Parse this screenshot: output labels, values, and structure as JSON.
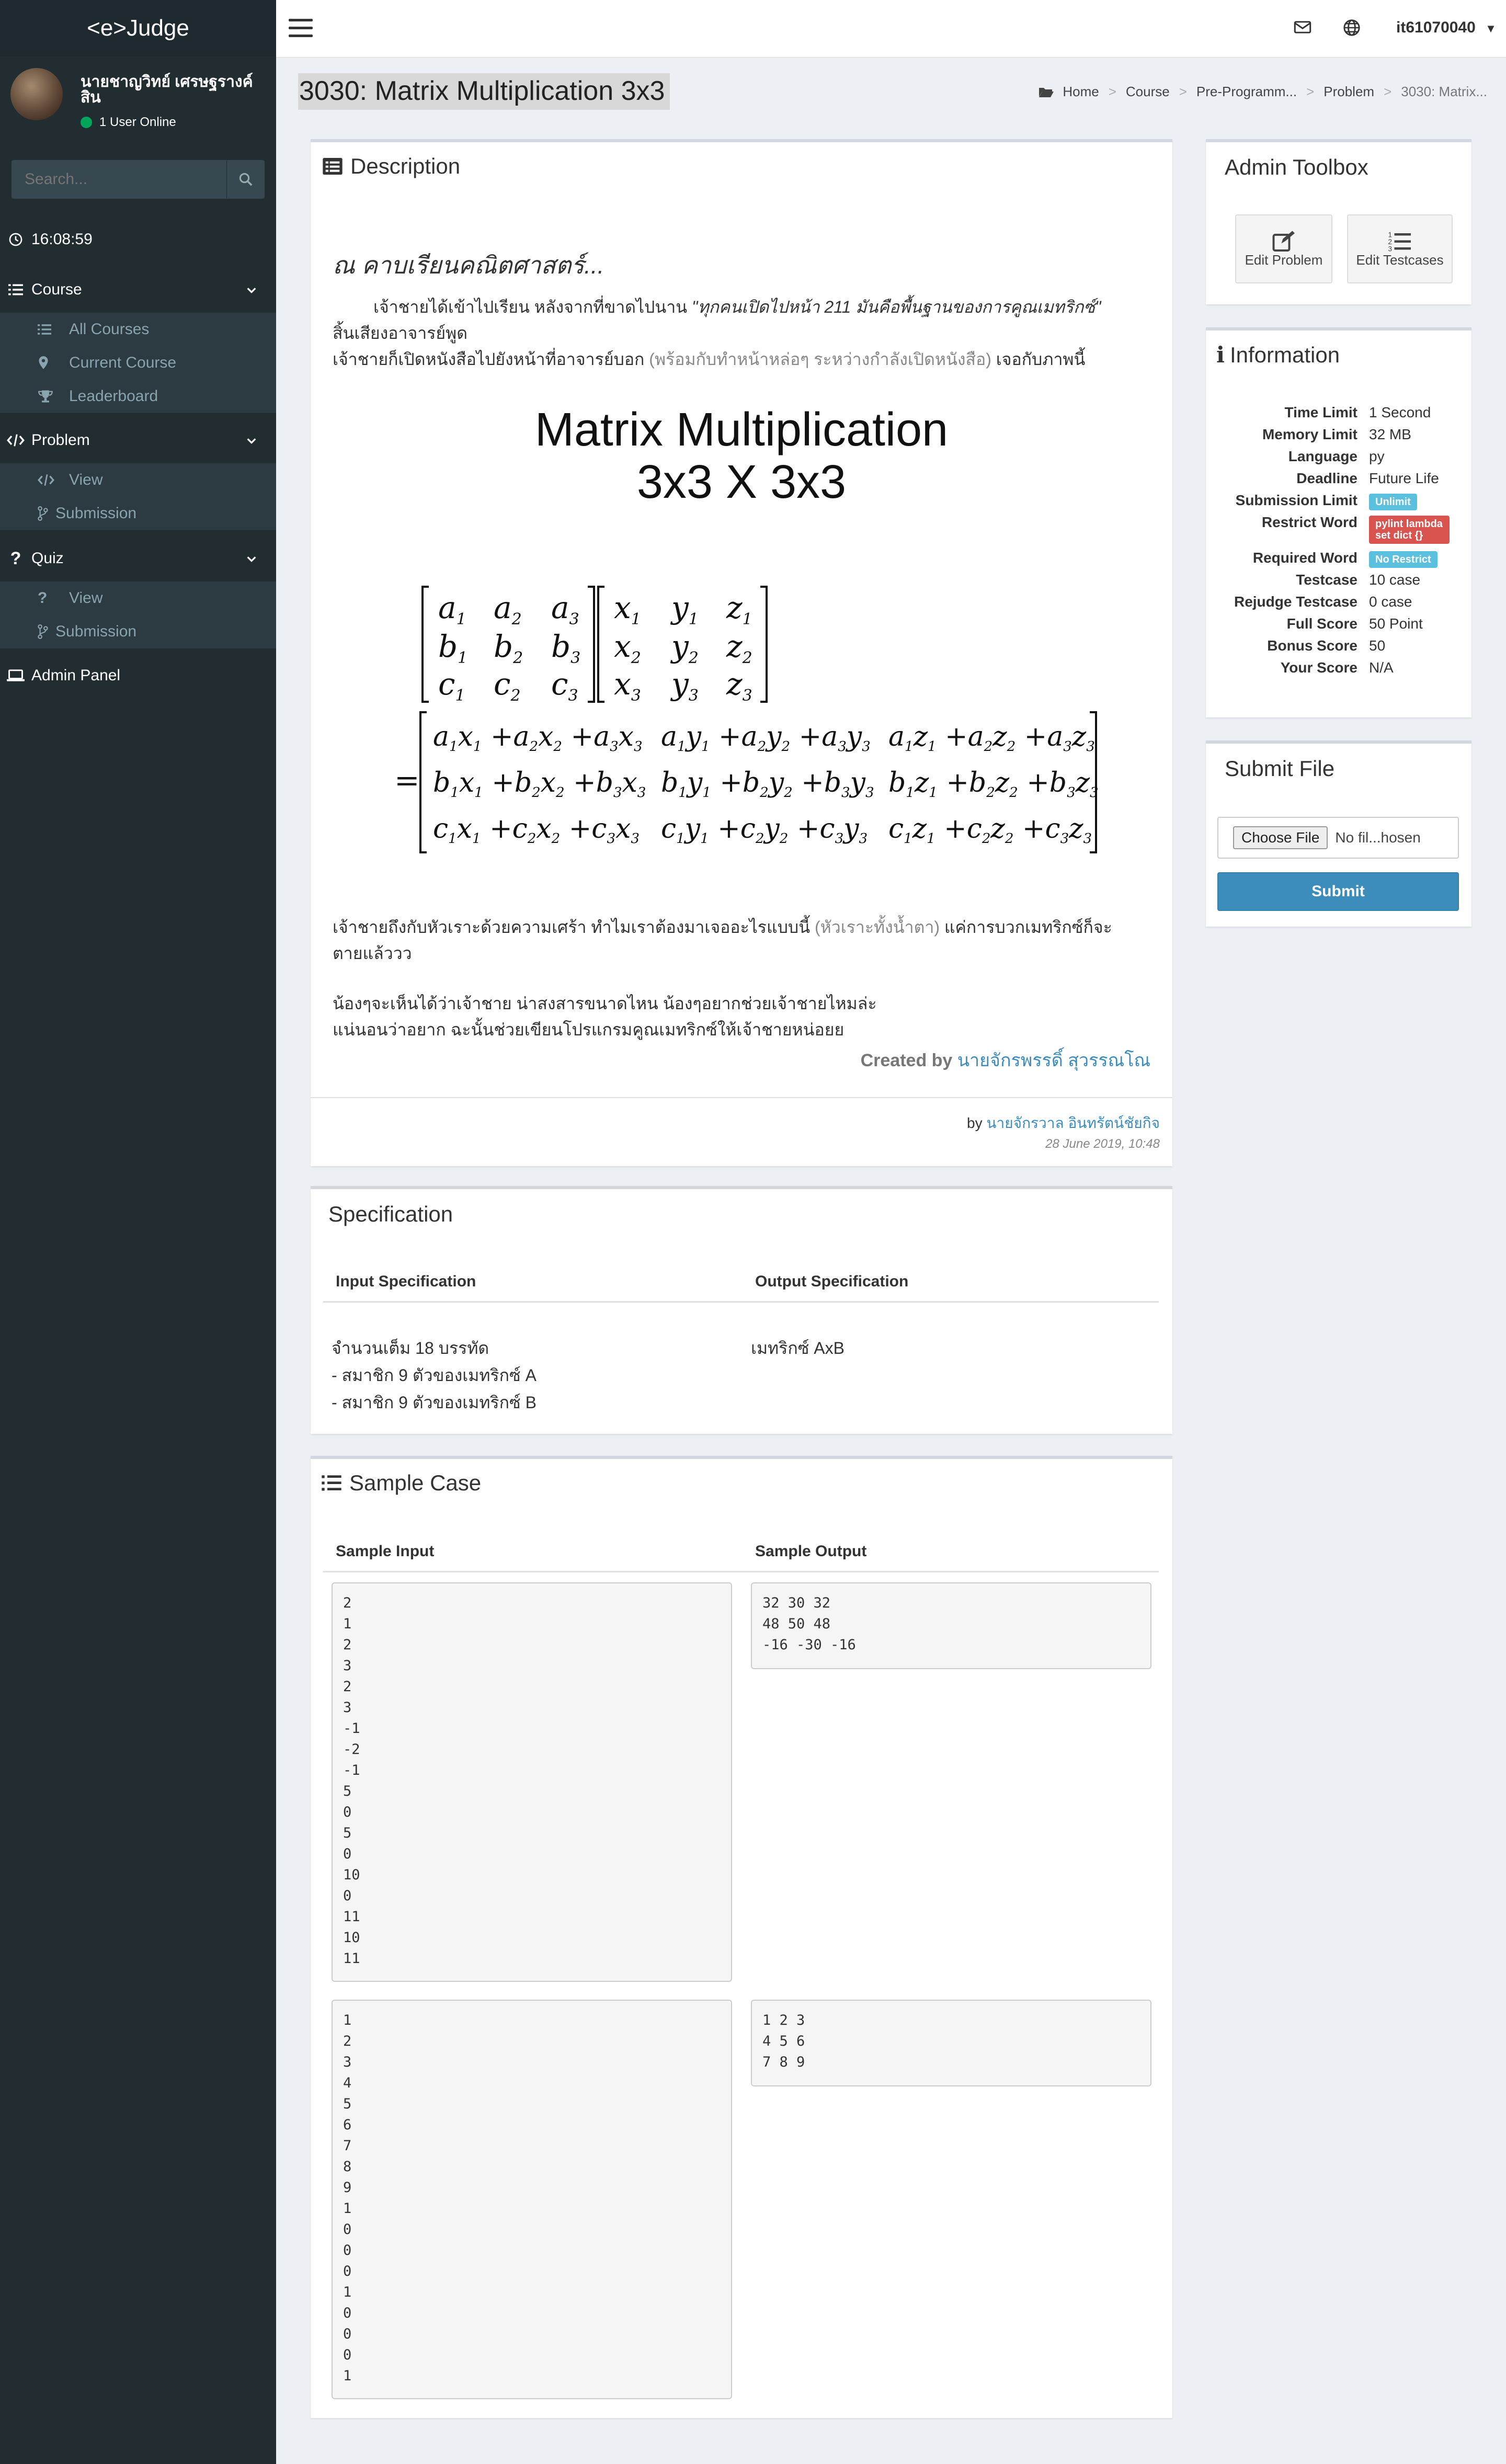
{
  "app": {
    "logo": "<e>Judge"
  },
  "user": {
    "name": "นายชาญวิทย์ เศรษฐรางค์สิน",
    "online": "1 User Online"
  },
  "search": {
    "placeholder": "Search..."
  },
  "clock": "16:08:59",
  "sidebar": {
    "course": {
      "label": "Course",
      "items": [
        "All Courses",
        "Current Course",
        "Leaderboard"
      ]
    },
    "problem": {
      "label": "Problem",
      "items": [
        "View",
        "Submission"
      ]
    },
    "quiz": {
      "label": "Quiz",
      "items": [
        "View",
        "Submission"
      ]
    },
    "admin": "Admin Panel"
  },
  "topbar": {
    "username": "it61070040"
  },
  "page": {
    "title": "3030: Matrix Multiplication 3x3"
  },
  "breadcrumb": [
    "Home",
    "Course",
    "Pre-Programm...",
    "Problem",
    "3030: Matrix..."
  ],
  "description": {
    "title": "Description",
    "heading": "ณ คาบเรียนคณิตศาสตร์...",
    "p1_a": "เจ้าชายได้เข้าไปเรียน หลังจากที่ขาดไปนาน",
    "p1_quote": "\"ทุกคนเปิดไปหน้า 211 มันคือพื้นฐานของการคูณเมทริกซ์\"",
    "p1_b": "สิ้นเสียงอาจารย์พูด",
    "p2_a": "เจ้าชายก็เปิดหนังสือไปยังหน้าที่อาจารย์บอก",
    "p2_note": "(พร้อมกับทำหน้าหล่อๆ ระหว่างกำลังเปิดหนังสือ)",
    "p2_b": "เจอกับภาพนี้",
    "img_title1": "Matrix Multiplication",
    "img_title2": "3x3  X  3x3",
    "p3_a": "เจ้าชายถึงกับหัวเราะด้วยความเศร้า ทำไมเราต้องมาเจออะไรแบบนี้",
    "p3_note": "(หัวเราะทั้งน้ำตา)",
    "p3_b": "แค่การบวกเมทริกซ์ก็จะ",
    "p3_c": "ตายแล้ววว",
    "p4": "น้องๆจะเห็นได้ว่าเจ้าชาย น่าสงสารขนาดไหน น้องๆอยากช่วยเจ้าชายไหมล่ะ",
    "p5": "แน่นอนว่าอยาก ฉะนั้นช่วยเขียนโปรแกรมคูณเมทริกซ์ให้เจ้าชายหน่อยย",
    "created_by_label": "Created by",
    "created_by_name": "นายจักรพรรดิ์ สุวรรณโณ",
    "by_label": "by",
    "author": "นายจักรวาล อินทรัตน์ชัยกิจ",
    "date": "28 June 2019, 10:48"
  },
  "specification": {
    "title": "Specification",
    "input_header": "Input Specification",
    "output_header": "Output Specification",
    "input_lines": [
      "จำนวนเต็ม 18 บรรทัด",
      "- สมาชิก 9 ตัวของเมทริกซ์ A",
      "- สมาชิก 9 ตัวของเมทริกซ์ B"
    ],
    "output": "เมทริกซ์ AxB"
  },
  "sample": {
    "title": "Sample Case",
    "input_header": "Sample Input",
    "output_header": "Sample Output",
    "cases": [
      {
        "input": "2\n1\n2\n3\n2\n3\n-1\n-2\n-1\n5\n0\n5\n0\n10\n0\n11\n10\n11",
        "output": "32 30 32\n48 50 48\n-16 -30 -16"
      },
      {
        "input": "1\n2\n3\n4\n5\n6\n7\n8\n9\n1\n0\n0\n0\n1\n0\n0\n0\n1",
        "output": "1 2 3\n4 5 6\n7 8 9"
      }
    ]
  },
  "toolbox": {
    "title": "Admin Toolbox",
    "edit_problem": "Edit Problem",
    "edit_testcases": "Edit Testcases"
  },
  "information": {
    "title": "Information",
    "time_limit": {
      "label": "Time Limit",
      "value": "1 Second"
    },
    "memory_limit": {
      "label": "Memory Limit",
      "value": "32 MB"
    },
    "language": {
      "label": "Language",
      "value": "py"
    },
    "deadline": {
      "label": "Deadline",
      "value": "Future Life"
    },
    "submission_limit": {
      "label": "Submission Limit",
      "value": "Unlimit"
    },
    "restrict_word": {
      "label": "Restrict Word",
      "value": "pylint lambda set dict {}"
    },
    "required_word": {
      "label": "Required Word",
      "value": "No Restrict"
    },
    "testcase": {
      "label": "Testcase",
      "value": "10 case"
    },
    "rejudge": {
      "label": "Rejudge Testcase",
      "value": "0 case"
    },
    "full_score": {
      "label": "Full Score",
      "value": "50 Point"
    },
    "bonus_score": {
      "label": "Bonus Score",
      "value": "50"
    },
    "your_score": {
      "label": "Your Score",
      "value": "N/A"
    }
  },
  "submit": {
    "title": "Submit File",
    "choose_file": "Choose File",
    "no_file": "No fil...hosen",
    "button": "Submit"
  },
  "colors": {
    "sidebar": "#222d32",
    "accent": "#3c8dbc",
    "badge_info": "#5bc0de",
    "badge_danger": "#d9534f",
    "online": "#00a65a"
  }
}
